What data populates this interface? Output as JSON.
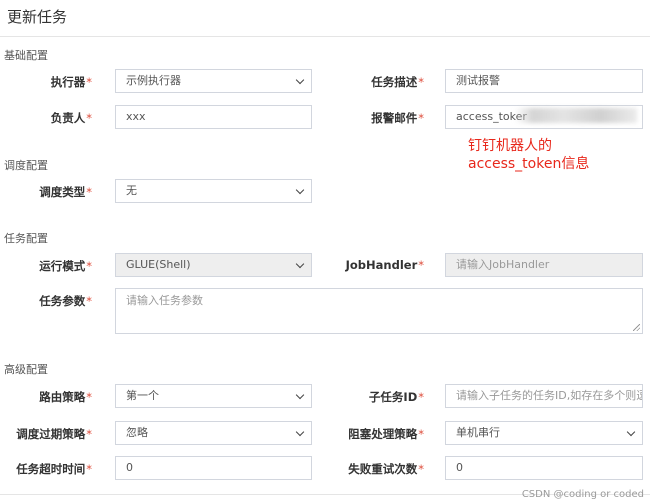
{
  "page": {
    "title": "更新任务"
  },
  "sections": {
    "basic": "基础配置",
    "schedule": "调度配置",
    "task": "任务配置",
    "advanced": "高级配置"
  },
  "fields": {
    "executor": {
      "label": "执行器",
      "value": "示例执行器"
    },
    "job_desc": {
      "label": "任务描述",
      "value": "测试报警"
    },
    "author": {
      "label": "负责人",
      "value": "xxx"
    },
    "alarm_email": {
      "label": "报警邮件",
      "value": "access_toker"
    },
    "schedule_type": {
      "label": "调度类型",
      "value": "无"
    },
    "glue_type": {
      "label": "运行模式",
      "value": "GLUE(Shell)"
    },
    "job_handler": {
      "label": "JobHandler",
      "placeholder": "请输入JobHandler"
    },
    "job_param": {
      "label": "任务参数",
      "placeholder": "请输入任务参数"
    },
    "route_strategy": {
      "label": "路由策略",
      "value": "第一个"
    },
    "child_job_id": {
      "label": "子任务ID",
      "placeholder": "请输入子任务的任务ID,如存在多个则逗"
    },
    "misfire_strategy": {
      "label": "调度过期策略",
      "value": "忽略"
    },
    "block_strategy": {
      "label": "阻塞处理策略",
      "value": "单机串行"
    },
    "timeout": {
      "label": "任务超时时间",
      "value": "0"
    },
    "fail_retry": {
      "label": "失败重试次数",
      "value": "0"
    }
  },
  "required_mark": "*",
  "annotation": {
    "line1": "钉钉机器人的",
    "line2": "access_token信息"
  },
  "watermark": "CSDN @coding or coded",
  "colors": {
    "annotation": "#e8271b",
    "required": "#dd4b39"
  }
}
